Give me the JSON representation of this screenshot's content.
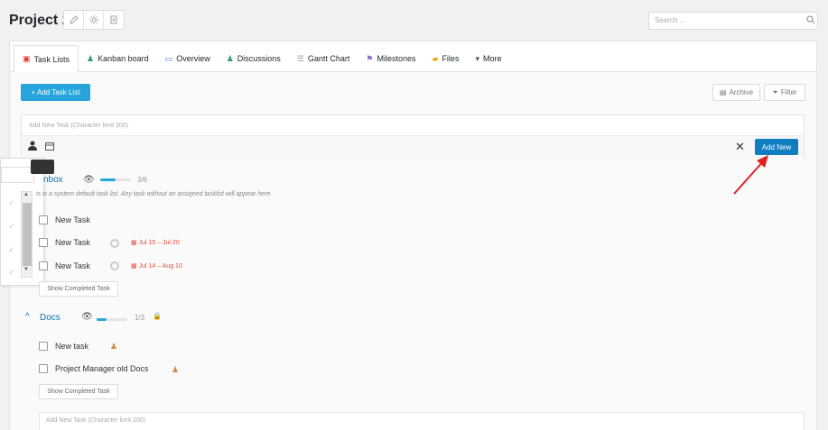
{
  "header": {
    "project_title": "Project 2",
    "search_placeholder": "Search ..."
  },
  "tabs": [
    {
      "label": "Task Lists",
      "icon": "task-list-icon",
      "active": true
    },
    {
      "label": "Kanban board",
      "icon": "kanban-icon"
    },
    {
      "label": "Overview",
      "icon": "overview-icon"
    },
    {
      "label": "Discussions",
      "icon": "discussions-icon"
    },
    {
      "label": "Gantt Chart",
      "icon": "gantt-icon"
    },
    {
      "label": "Milestones",
      "icon": "milestones-icon"
    },
    {
      "label": "Files",
      "icon": "folder-icon"
    },
    {
      "label": "More",
      "icon": "caret-down-icon"
    }
  ],
  "toolbar": {
    "add_task_list": "+ Add Task List",
    "archive": "Archive",
    "filter": "Filter"
  },
  "task_form": {
    "placeholder": "Add New Task (Character limit 200)",
    "add_new": "Add New",
    "close": "✕"
  },
  "inbox": {
    "title": "Inbox",
    "title_visible": "nbox",
    "progress": "3/6",
    "progress_fraction": 0.5,
    "description": "This is a system default task list. Any task without an assigned tasklist will appear here.",
    "description_visible": "is is a system default task list. Any task without an assigned tasklist will appear here.",
    "tasks": [
      {
        "name": "New Task",
        "due": ""
      },
      {
        "name": "New Task",
        "due": "Jul 15 – Jul 20"
      },
      {
        "name": "New Task",
        "due": "Jul 14 – Aug 10"
      }
    ],
    "show_completed": "Show Completed Task"
  },
  "docs": {
    "title": "Docs",
    "progress": "1/3",
    "progress_fraction": 0.33,
    "tasks": [
      {
        "name": "New task"
      },
      {
        "name": "Project Manager old Docs"
      }
    ],
    "show_completed": "Show Completed Task",
    "new_task_placeholder": "Add New Task (Character limit 200)"
  },
  "colors": {
    "primary": "#27a4db",
    "add_new": "#0f7dbf",
    "due": "#e74c3c",
    "list_title": "#0f6fb0"
  }
}
